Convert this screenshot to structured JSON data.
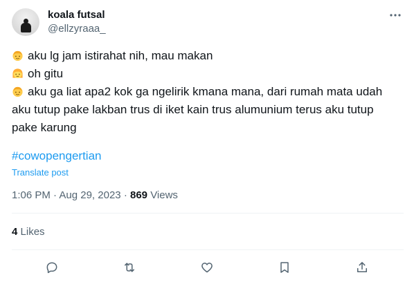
{
  "author": {
    "display_name": "koala futsal",
    "handle": "@ellzyraaa_"
  },
  "tweet": {
    "lines": [
      {
        "emoji": "boy-face",
        "text": "aku lg jam istirahat nih, mau makan"
      },
      {
        "emoji": "girl-face",
        "text": "oh gitu"
      },
      {
        "emoji": "boy-face",
        "text": "aku ga liat apa2 kok ga ngelirik kmana mana, dari rumah mata udah"
      },
      {
        "emoji": "",
        "text": "aku tutup pake lakban trus di iket kain trus alumunium terus aku tutup"
      },
      {
        "emoji": "",
        "text": "pake karung"
      }
    ],
    "hashtag": "#cowopengertian",
    "translate_label": "Translate post"
  },
  "meta": {
    "time": "1:06 PM",
    "date": "Aug 29, 2023",
    "views_count": "869",
    "views_label": "Views"
  },
  "likes": {
    "count": "4",
    "label": "Likes"
  },
  "colors": {
    "text": "#0f1419",
    "secondary": "#536471",
    "link": "#1d9bf0",
    "divider": "#eff3f4"
  },
  "icons": {
    "more": "more-dots-icon",
    "reply": "reply-icon",
    "retweet": "retweet-icon",
    "like": "heart-icon",
    "bookmark": "bookmark-icon",
    "share": "share-icon"
  }
}
